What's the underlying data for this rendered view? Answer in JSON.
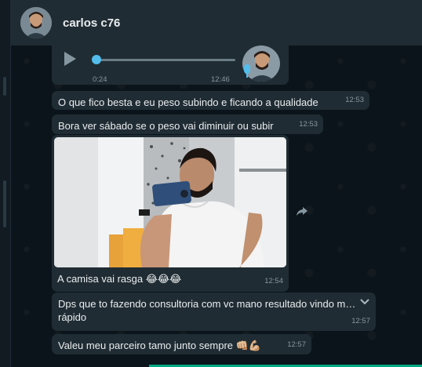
{
  "header": {
    "contact_name": "carlos c76"
  },
  "audio_message": {
    "duration": "0:24",
    "time": "12:46"
  },
  "messages": [
    {
      "text": "O que fico besta e eu peso subindo e ficando a qualidade",
      "time": "12:53"
    },
    {
      "text": "Bora ver sábado se o peso vai diminuir ou subir",
      "time": "12:53"
    }
  ],
  "photo_message": {
    "caption": "A camisa vai rasga 😂😂😂",
    "time": "12:54"
  },
  "messages_after": [
    {
      "text": "Dps que to fazendo consultoria com vc mano resultado vindo m… rápido",
      "time": "12:57"
    },
    {
      "text": "Valeu meu parceiro tamo junto sempre 👊🏼💪🏼",
      "time": "12:57"
    }
  ],
  "colors": {
    "background": "#0b141a",
    "header": "#202c33",
    "bubble": "#202c33",
    "accent": "#53bdeb",
    "meta_text": "#8696a0"
  },
  "icons": {
    "play": "play-icon",
    "mic": "mic-icon",
    "forward": "forward-icon",
    "dropdown": "chevron-down-icon"
  }
}
